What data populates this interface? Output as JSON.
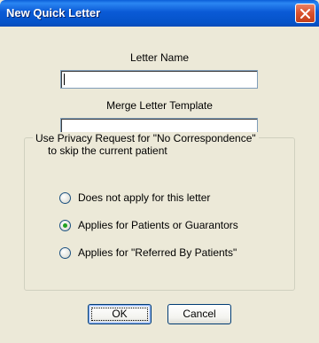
{
  "window": {
    "title": "New Quick Letter",
    "close_icon": "close-icon"
  },
  "letter_name": {
    "label": "Letter Name",
    "value": ""
  },
  "merge_template": {
    "label": "Merge Letter Template",
    "value": ""
  },
  "privacy_group": {
    "label_line1": "Use Privacy Request for \"No Correspondence\"",
    "label_line2": "to skip the current patient",
    "options": [
      {
        "label": "Does not apply for this letter",
        "selected": false
      },
      {
        "label": "Applies for Patients or Guarantors",
        "selected": true
      },
      {
        "label": "Applies for \"Referred By Patients\"",
        "selected": false
      }
    ]
  },
  "buttons": {
    "ok": "OK",
    "cancel": "Cancel"
  },
  "colors": {
    "titlebar": "#0a5ad6",
    "close": "#d9512d",
    "dialog_bg": "#ece9d8"
  }
}
